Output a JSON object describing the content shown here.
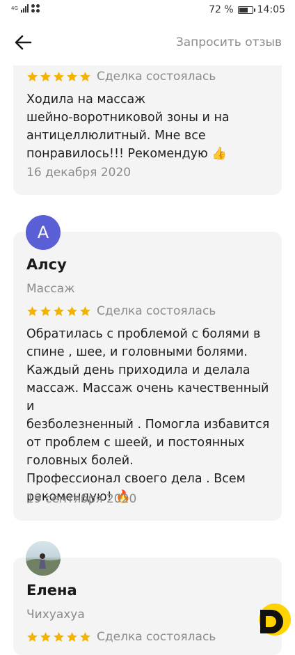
{
  "status_bar": {
    "network_label": "4G",
    "battery_percent": "72 %",
    "battery_level": 0.72,
    "time": "14:05"
  },
  "header": {
    "back_icon": "arrow-left-icon",
    "request_review_label": "Запросить отзыв"
  },
  "reviews": [
    {
      "rating_stars": 5,
      "deal_status": "Сделка состоялась",
      "text": "Ходила на массаж\nшейно-воротниковой зоны и на\nантицеллюлитный. Мне все\nпонравилось!!! Рекомендую 👍",
      "date": "16 декабря 2020"
    },
    {
      "avatar_letter": "А",
      "author": "Алсу",
      "service": "Массаж",
      "rating_stars": 5,
      "deal_status": "Сделка состоялась",
      "text": "Обратилась с проблемой с болями в\nспине , шее, и головными болями.\nКаждый день приходила и делала\nмассаж. Массаж очень качественный и\nбезболезненный . Помогла избавится\nот проблем с шеей, и постоянных\nголовных болей.\nПрофессионал своего дела . Всем\nрекомендую! 🔥",
      "date": "19 сентября 2020"
    },
    {
      "author": "Елена",
      "service": "Чихуахуа",
      "rating_stars": 5,
      "deal_status": "Сделка состоялась"
    }
  ],
  "colors": {
    "star": "#f5b301",
    "avatar_bg": "#5b5fd6",
    "card_bg": "#f4f4f4",
    "muted_text": "#8a8a8a",
    "fab_yellow": "#ffd200"
  }
}
